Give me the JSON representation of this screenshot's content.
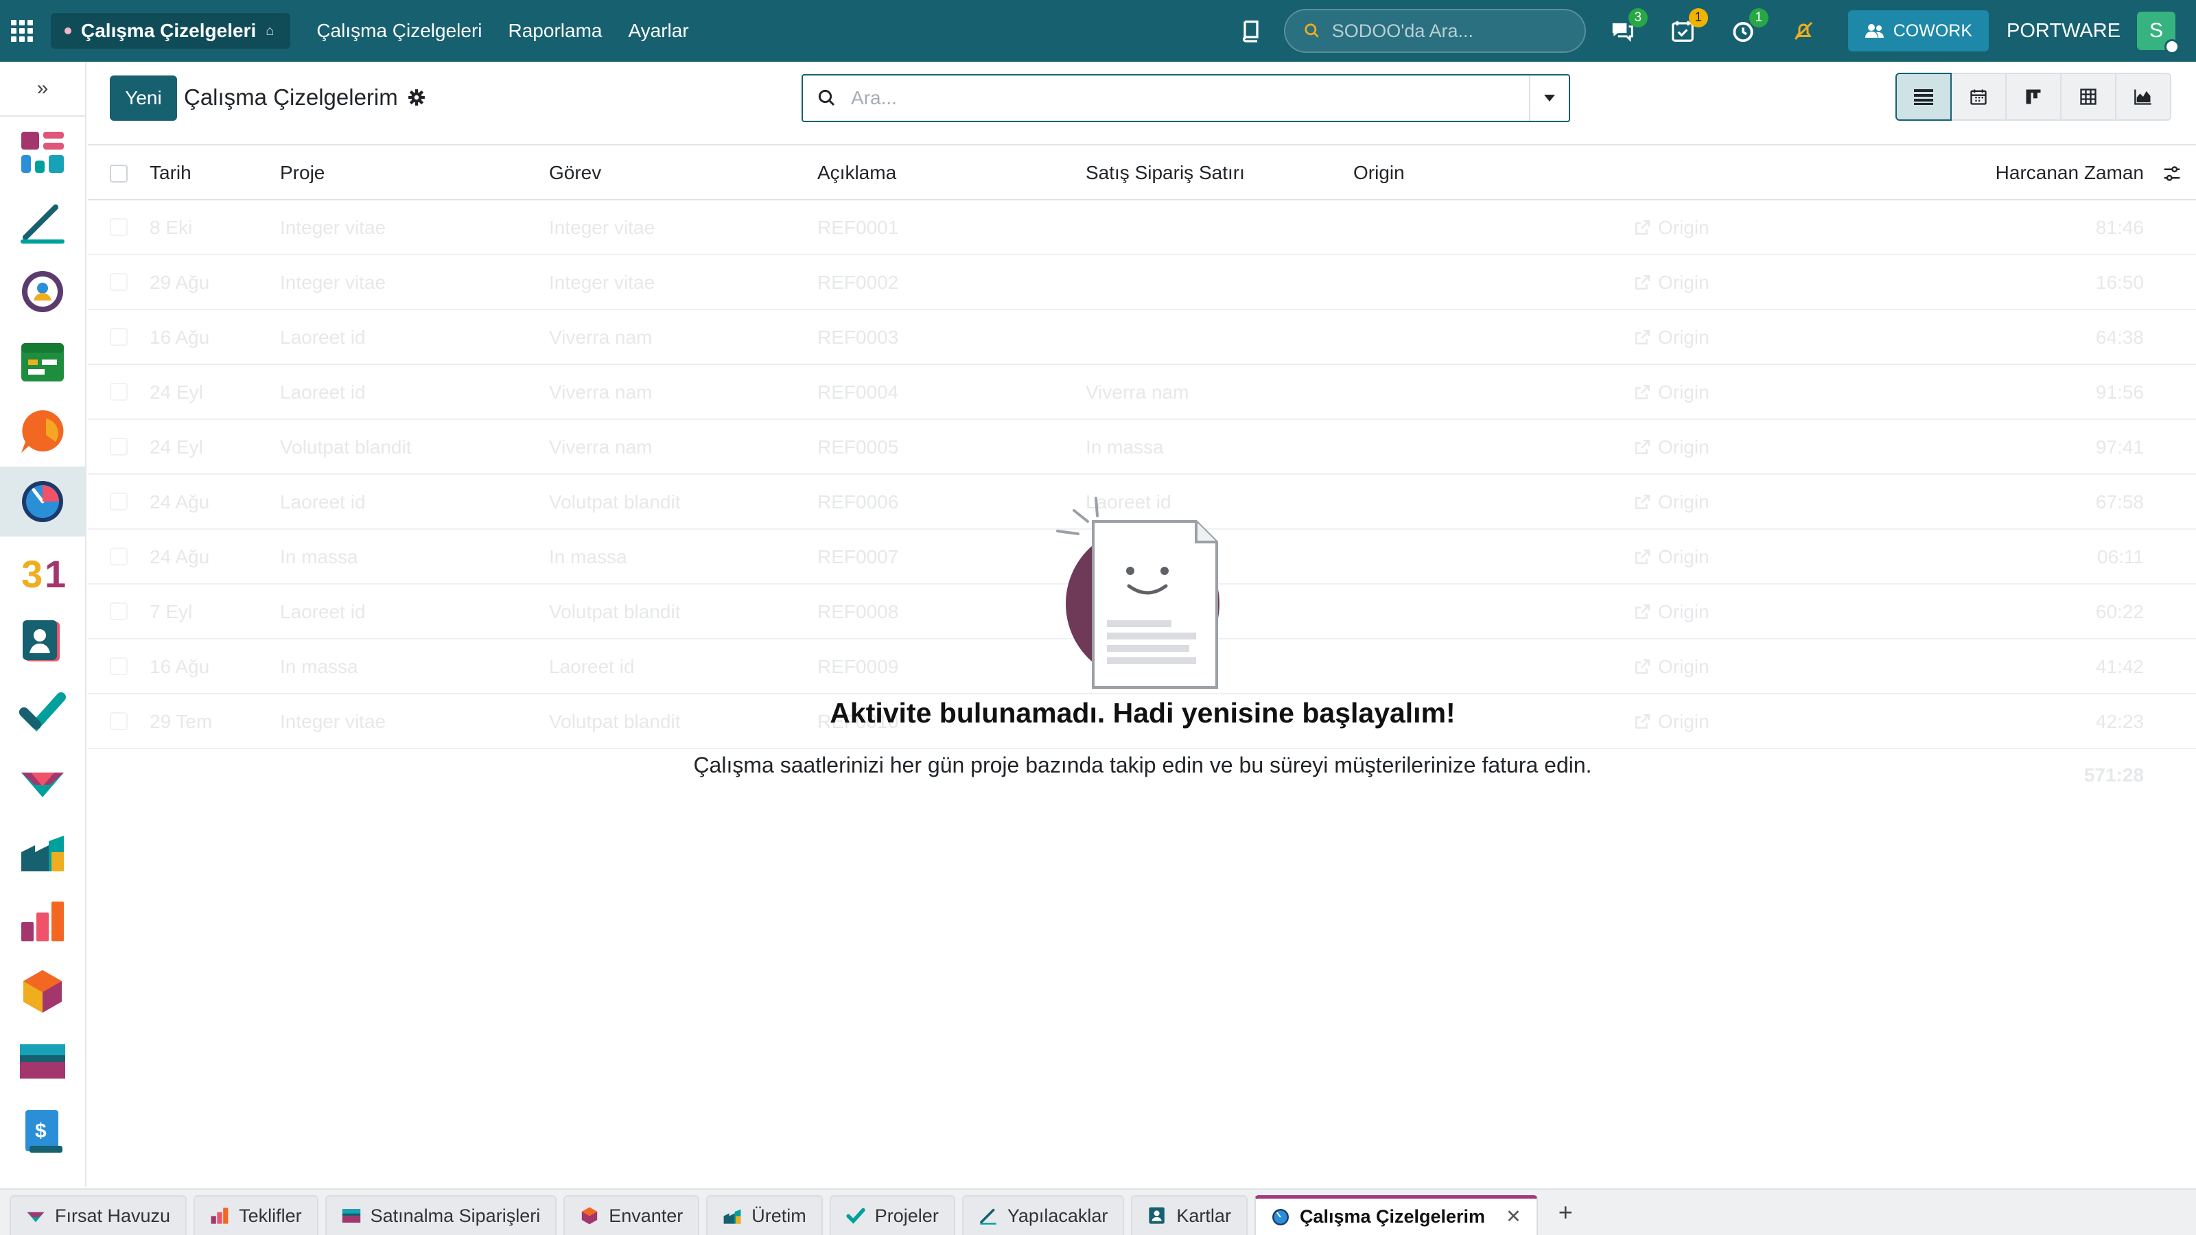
{
  "topbar": {
    "app_name": "Çalışma Çizelgeleri",
    "menu": [
      "Çalışma Çizelgeleri",
      "Raporlama",
      "Ayarlar"
    ],
    "search_placeholder": "SODOO'da Ara...",
    "badges": {
      "messages": "3",
      "activities": "1",
      "timer": "1"
    },
    "cowork_label": "COWORK",
    "company": "PORTWARE",
    "avatar_letter": "S"
  },
  "control": {
    "new_label": "Yeni",
    "title": "Çalışma Çizelgelerim",
    "search_placeholder": "Ara..."
  },
  "table": {
    "columns": [
      "Tarih",
      "Proje",
      "Görev",
      "Açıklama",
      "Satış Sipariş Satırı",
      "Origin",
      "Harcanan Zaman"
    ],
    "rows": [
      {
        "date": "8 Eki",
        "project": "Integer vitae",
        "task": "Integer vitae",
        "desc": "REF0001",
        "sol": "",
        "origin": "Origin",
        "time": "81:46"
      },
      {
        "date": "29 Ağu",
        "project": "Integer vitae",
        "task": "Integer vitae",
        "desc": "REF0002",
        "sol": "",
        "origin": "Origin",
        "time": "16:50"
      },
      {
        "date": "16 Ağu",
        "project": "Laoreet id",
        "task": "Viverra nam",
        "desc": "REF0003",
        "sol": "",
        "origin": "Origin",
        "time": "64:38"
      },
      {
        "date": "24 Eyl",
        "project": "Laoreet id",
        "task": "Viverra nam",
        "desc": "REF0004",
        "sol": "Viverra nam",
        "origin": "Origin",
        "time": "91:56"
      },
      {
        "date": "24 Eyl",
        "project": "Volutpat blandit",
        "task": "Viverra nam",
        "desc": "REF0005",
        "sol": "In massa",
        "origin": "Origin",
        "time": "97:41"
      },
      {
        "date": "24 Ağu",
        "project": "Laoreet id",
        "task": "Volutpat blandit",
        "desc": "REF0006",
        "sol": "Laoreet id",
        "origin": "Origin",
        "time": "67:58"
      },
      {
        "date": "24 Ağu",
        "project": "In massa",
        "task": "In massa",
        "desc": "REF0007",
        "sol": "",
        "origin": "Origin",
        "time": "06:11"
      },
      {
        "date": "7 Eyl",
        "project": "Laoreet id",
        "task": "Volutpat blandit",
        "desc": "REF0008",
        "sol": "",
        "origin": "Origin",
        "time": "60:22"
      },
      {
        "date": "16 Ağu",
        "project": "In massa",
        "task": "Laoreet id",
        "desc": "REF0009",
        "sol": "",
        "origin": "Origin",
        "time": "41:42"
      },
      {
        "date": "29 Tem",
        "project": "Integer vitae",
        "task": "Volutpat blandit",
        "desc": "REF0010",
        "sol": "",
        "origin": "Origin",
        "time": "42:23"
      }
    ],
    "total": "571:28"
  },
  "empty": {
    "title": "Aktivite bulunamadı. Hadi yenisine başlayalım!",
    "text": "Çalışma saatlerinizi her gün proje bazında takip edin ve bu süreyi müşterilerinize fatura edin."
  },
  "tabs": [
    {
      "label": "Fırsat Havuzu",
      "icon": "crm-icon"
    },
    {
      "label": "Teklifler",
      "icon": "sales-icon"
    },
    {
      "label": "Satınalma Siparişleri",
      "icon": "purchase-icon"
    },
    {
      "label": "Envanter",
      "icon": "inventory-icon"
    },
    {
      "label": "Üretim",
      "icon": "manufacturing-icon"
    },
    {
      "label": "Projeler",
      "icon": "project-icon"
    },
    {
      "label": "Yapılacaklar",
      "icon": "todo-icon"
    },
    {
      "label": "Kartlar",
      "icon": "contacts-icon"
    },
    {
      "label": "Çalışma Çizelgelerim",
      "icon": "timesheet-icon",
      "active": true
    }
  ],
  "colors": {
    "brand": "#17606f",
    "active_tab": "#a0397d"
  }
}
